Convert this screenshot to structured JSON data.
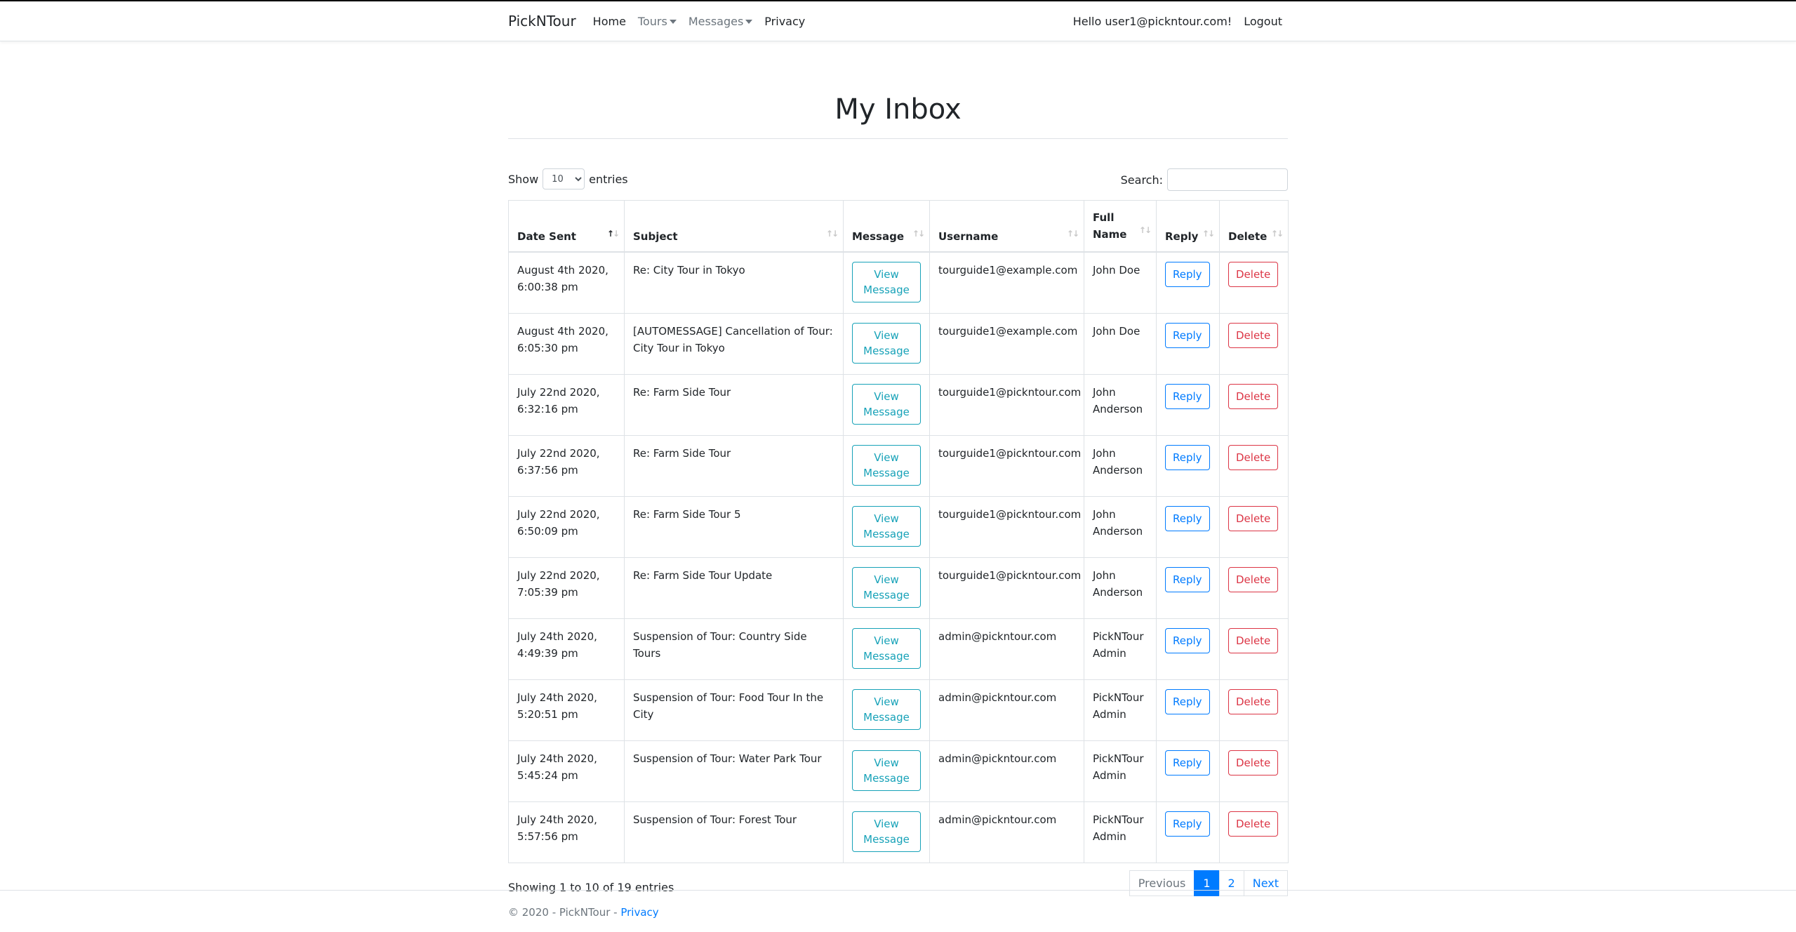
{
  "nav": {
    "brand": "PickNTour",
    "home": "Home",
    "tours": "Tours",
    "messages": "Messages",
    "privacy": "Privacy",
    "hello": "Hello user1@pickntour.com!",
    "logout": "Logout"
  },
  "page": {
    "title": "My Inbox"
  },
  "controls": {
    "show_label": "Show",
    "entries_label": "entries",
    "length_value": "10",
    "search_label": "Search:"
  },
  "table": {
    "headers": [
      "Date Sent",
      "Subject",
      "Message",
      "Username",
      "Full Name",
      "Reply",
      "Delete"
    ],
    "view_label": "View Message",
    "reply_label": "Reply",
    "delete_label": "Delete",
    "rows": [
      {
        "date": "August 4th 2020, 6:00:38 pm",
        "subject": "Re: City Tour in Tokyo",
        "username": "tourguide1@example.com",
        "fullname": "John Doe"
      },
      {
        "date": "August 4th 2020, 6:05:30 pm",
        "subject": "[AUTOMESSAGE] Cancellation of Tour: City Tour in Tokyo",
        "username": "tourguide1@example.com",
        "fullname": "John Doe"
      },
      {
        "date": "July 22nd 2020, 6:32:16 pm",
        "subject": "Re: Farm Side Tour",
        "username": "tourguide1@pickntour.com",
        "fullname": "John Anderson"
      },
      {
        "date": "July 22nd 2020, 6:37:56 pm",
        "subject": "Re: Farm Side Tour",
        "username": "tourguide1@pickntour.com",
        "fullname": "John Anderson"
      },
      {
        "date": "July 22nd 2020, 6:50:09 pm",
        "subject": "Re: Farm Side Tour 5",
        "username": "tourguide1@pickntour.com",
        "fullname": "John Anderson"
      },
      {
        "date": "July 22nd 2020, 7:05:39 pm",
        "subject": "Re: Farm Side Tour Update",
        "username": "tourguide1@pickntour.com",
        "fullname": "John Anderson"
      },
      {
        "date": "July 24th 2020, 4:49:39 pm",
        "subject": "Suspension of Tour: Country Side Tours",
        "username": "admin@pickntour.com",
        "fullname": "PickNTour Admin"
      },
      {
        "date": "July 24th 2020, 5:20:51 pm",
        "subject": "Suspension of Tour: Food Tour In the City",
        "username": "admin@pickntour.com",
        "fullname": "PickNTour Admin"
      },
      {
        "date": "July 24th 2020, 5:45:24 pm",
        "subject": "Suspension of Tour: Water Park Tour",
        "username": "admin@pickntour.com",
        "fullname": "PickNTour Admin"
      },
      {
        "date": "July 24th 2020, 5:57:56 pm",
        "subject": "Suspension of Tour: Forest Tour",
        "username": "admin@pickntour.com",
        "fullname": "PickNTour Admin"
      }
    ]
  },
  "pagination": {
    "info": "Showing 1 to 10 of 19 entries",
    "previous": "Previous",
    "page1": "1",
    "page2": "2",
    "next": "Next"
  },
  "footer": {
    "text": "© 2020 - PickNTour - ",
    "privacy": "Privacy"
  },
  "colors": {
    "primary": "#007bff",
    "info": "#17a2b8",
    "danger": "#dc3545"
  }
}
